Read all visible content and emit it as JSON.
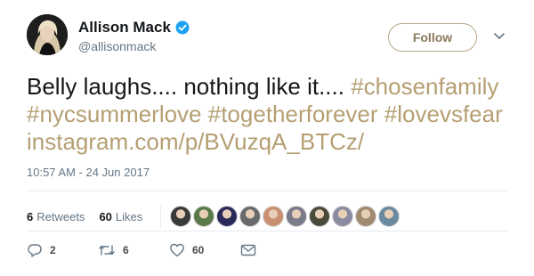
{
  "user": {
    "display_name": "Allison Mack",
    "handle": "@allisonmack",
    "verified": true
  },
  "follow_label": "Follow",
  "tweet": {
    "text_plain": "Belly laughs.... nothing like it.... ",
    "hashtag_1": "#chosenfamily",
    "hashtag_2": "#nycsummerlove",
    "hashtag_3": "#togetherforever",
    "hashtag_4": "#lovevsfear",
    "link": "instagram.com/p/BVuzqA_BTCz/"
  },
  "timestamp": "10:57 AM - 24 Jun 2017",
  "stats": {
    "retweets_count": "6",
    "retweets_label": "Retweets",
    "likes_count": "60",
    "likes_label": "Likes"
  },
  "likers": [
    {
      "color": "#3a3a3a"
    },
    {
      "color": "#5a7a4a"
    },
    {
      "color": "#2a2a5a"
    },
    {
      "color": "#6a6a6a"
    },
    {
      "color": "#c89070"
    },
    {
      "color": "#7a7a8a"
    },
    {
      "color": "#4a4a3a"
    },
    {
      "color": "#8a8aa0"
    },
    {
      "color": "#a08a70"
    },
    {
      "color": "#6a8aa0"
    }
  ],
  "actions": {
    "reply_count": "2",
    "retweet_count": "6",
    "like_count": "60"
  },
  "colors": {
    "link": "#b59f72",
    "verified": "#1da1f2"
  }
}
